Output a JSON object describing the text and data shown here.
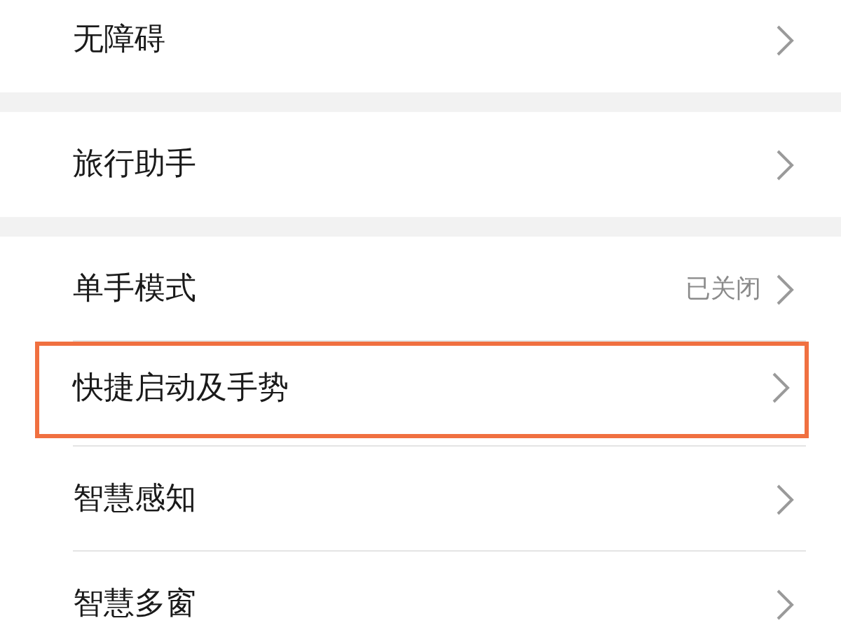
{
  "groups": [
    {
      "items": [
        {
          "label": "无障碍",
          "highlighted": false
        }
      ]
    },
    {
      "items": [
        {
          "label": "旅行助手",
          "highlighted": false
        }
      ]
    },
    {
      "items": [
        {
          "label": "单手模式",
          "value": "已关闭",
          "highlighted": false
        },
        {
          "label": "快捷启动及手势",
          "highlighted": true
        },
        {
          "label": "智慧感知",
          "highlighted": false
        },
        {
          "label": "智慧多窗",
          "highlighted": false
        }
      ]
    }
  ]
}
